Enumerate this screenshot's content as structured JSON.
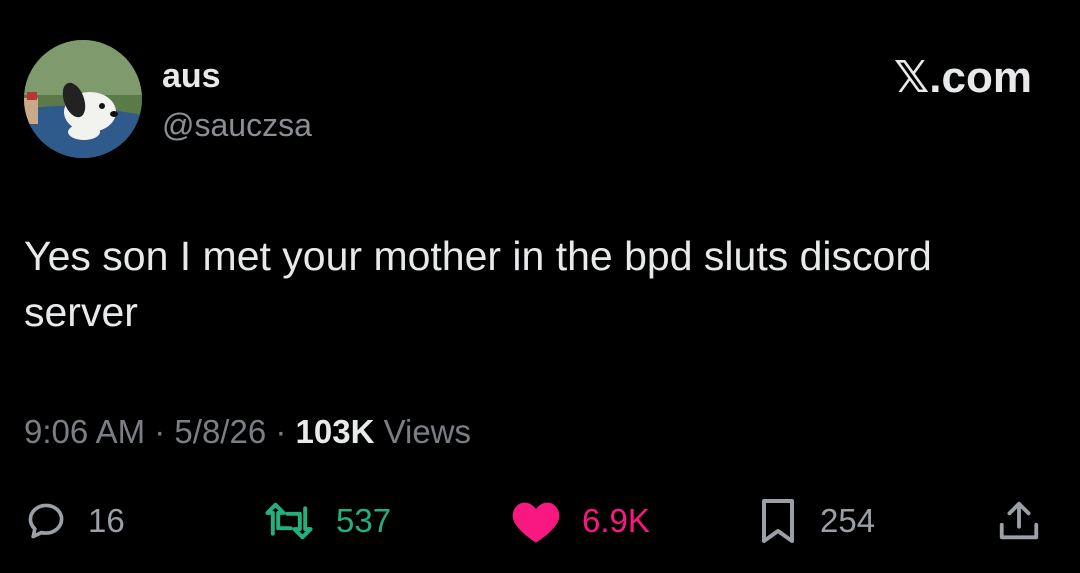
{
  "author": {
    "display_name": "aus",
    "handle": "@sauczsa"
  },
  "brand": "𝕏.com",
  "tweet": {
    "text": "Yes son I met your mother in the bpd sluts discord server"
  },
  "meta": {
    "time": "9:06 AM",
    "date": "5/8/26",
    "views_count": "103K",
    "views_label": "Views",
    "separator": "·"
  },
  "actions": {
    "replies": "16",
    "retweets": "537",
    "likes": "6.9K",
    "bookmarks": "254"
  },
  "colors": {
    "background": "#000000",
    "retweet": "#22b07d",
    "like": "#f91880",
    "muted": "#7b7f84"
  },
  "icons": [
    "reply-icon",
    "retweet-icon",
    "like-icon",
    "bookmark-icon",
    "share-icon"
  ]
}
